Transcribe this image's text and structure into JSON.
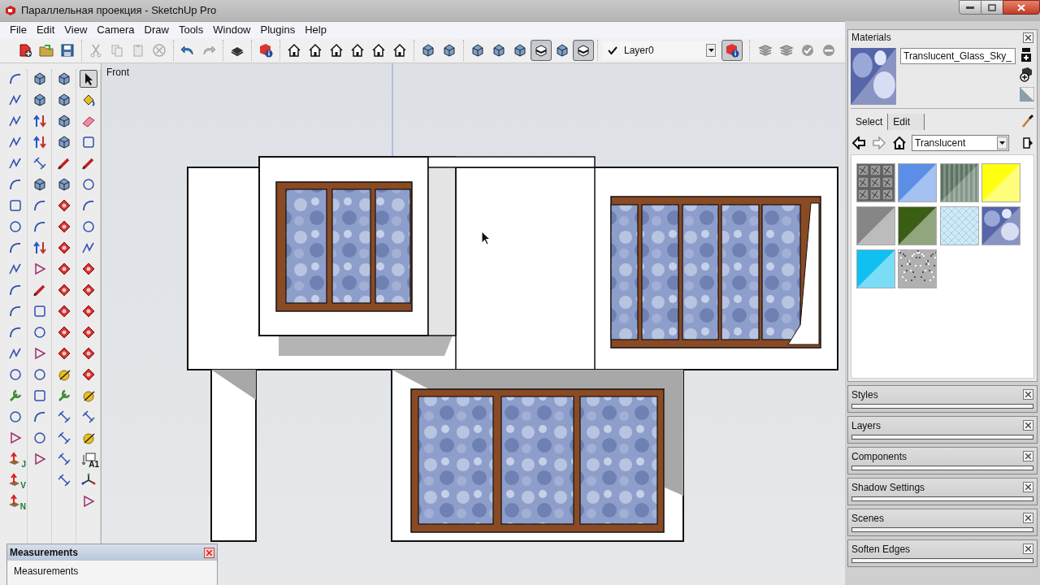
{
  "window": {
    "title": "Параллельная проекция - SketchUp Pro"
  },
  "menu": [
    "File",
    "Edit",
    "View",
    "Camera",
    "Draw",
    "Tools",
    "Window",
    "Plugins",
    "Help"
  ],
  "toolbar": {
    "groups": [
      [
        {
          "kind": "new",
          "selected": false
        },
        {
          "kind": "open",
          "selected": false
        },
        {
          "kind": "save",
          "selected": false
        }
      ],
      [
        {
          "kind": "cut",
          "selected": false
        },
        {
          "kind": "copy",
          "selected": false
        },
        {
          "kind": "paste",
          "selected": false
        },
        {
          "kind": "delete",
          "selected": false
        }
      ],
      [
        {
          "kind": "undo",
          "selected": false
        },
        {
          "kind": "redo",
          "selected": false
        }
      ],
      [
        {
          "kind": "print",
          "selected": false
        }
      ],
      [
        {
          "kind": "info",
          "selected": false
        }
      ],
      [
        {
          "kind": "house",
          "selected": false
        },
        {
          "kind": "house",
          "selected": false
        },
        {
          "kind": "house",
          "selected": false
        },
        {
          "kind": "house",
          "selected": false
        },
        {
          "kind": "house",
          "selected": false
        },
        {
          "kind": "house",
          "selected": false
        }
      ],
      [
        {
          "kind": "cube",
          "selected": false
        },
        {
          "kind": "cube",
          "selected": false
        }
      ],
      [
        {
          "kind": "cube",
          "selected": false
        },
        {
          "kind": "cube",
          "selected": false
        },
        {
          "kind": "cube",
          "selected": false
        },
        {
          "kind": "style",
          "selected": true
        },
        {
          "kind": "cube",
          "selected": false
        },
        {
          "kind": "style",
          "selected": true
        }
      ]
    ],
    "layer": {
      "name": "Layer0",
      "checked": true,
      "info_selected": true
    },
    "tail": [
      {
        "kind": "layers",
        "selected": false
      },
      {
        "kind": "layers",
        "selected": false
      },
      {
        "kind": "check",
        "selected": false
      },
      {
        "kind": "minus",
        "selected": false
      }
    ]
  },
  "tools": [
    [
      {
        "kind": "arc",
        "selected": false
      },
      {
        "kind": "zigzag",
        "selected": false
      },
      {
        "kind": "zigzag",
        "selected": false
      },
      {
        "kind": "zigzag",
        "selected": false
      },
      {
        "kind": "zigzag",
        "selected": false
      },
      {
        "kind": "arc",
        "selected": false
      },
      {
        "kind": "square",
        "selected": false
      },
      {
        "kind": "circle",
        "selected": false
      },
      {
        "kind": "arc",
        "selected": false
      },
      {
        "kind": "zigzag",
        "selected": false
      },
      {
        "kind": "arc",
        "selected": false
      },
      {
        "kind": "arc",
        "selected": false
      },
      {
        "kind": "arc",
        "selected": false
      },
      {
        "kind": "zigzag",
        "selected": false
      },
      {
        "kind": "circle",
        "selected": false
      },
      {
        "kind": "wrench",
        "selected": false
      },
      {
        "kind": "circle",
        "selected": false
      },
      {
        "kind": "polygon",
        "selected": false
      },
      {
        "kind": "axis",
        "label": "J",
        "selected": false
      },
      {
        "kind": "axis",
        "label": "V",
        "selected": false
      },
      {
        "kind": "axis",
        "label": "N",
        "selected": false
      }
    ],
    [
      {
        "kind": "cube",
        "selected": false
      },
      {
        "kind": "cube",
        "selected": false
      },
      {
        "kind": "push",
        "selected": false
      },
      {
        "kind": "push",
        "selected": false
      },
      {
        "kind": "lines",
        "selected": false
      },
      {
        "kind": "cube",
        "selected": false
      },
      {
        "kind": "arc",
        "selected": false
      },
      {
        "kind": "arc",
        "selected": false
      },
      {
        "kind": "push",
        "selected": false
      },
      {
        "kind": "polygon",
        "selected": false
      },
      {
        "kind": "pencil",
        "selected": false
      },
      {
        "kind": "square",
        "selected": false
      },
      {
        "kind": "circle",
        "selected": false
      },
      {
        "kind": "polygon",
        "selected": false
      },
      {
        "kind": "circle",
        "selected": false
      },
      {
        "kind": "square",
        "selected": false
      },
      {
        "kind": "arc",
        "selected": false
      },
      {
        "kind": "circle",
        "selected": false
      },
      {
        "kind": "polygon",
        "selected": false
      }
    ],
    [
      {
        "kind": "cube",
        "selected": false
      },
      {
        "kind": "cube",
        "selected": false
      },
      {
        "kind": "cube",
        "selected": false
      },
      {
        "kind": "cube",
        "selected": false
      },
      {
        "kind": "pencil",
        "selected": false
      },
      {
        "kind": "cube",
        "selected": false
      },
      {
        "kind": "red",
        "selected": false
      },
      {
        "kind": "red",
        "selected": false
      },
      {
        "kind": "red",
        "selected": false
      },
      {
        "kind": "red",
        "selected": false
      },
      {
        "kind": "red",
        "selected": false
      },
      {
        "kind": "red",
        "selected": false
      },
      {
        "kind": "red",
        "selected": false
      },
      {
        "kind": "red",
        "selected": false
      },
      {
        "kind": "tape",
        "selected": false
      },
      {
        "kind": "wrench",
        "selected": false
      },
      {
        "kind": "lines",
        "selected": false
      },
      {
        "kind": "lines",
        "selected": false
      },
      {
        "kind": "lines",
        "selected": false
      },
      {
        "kind": "lines",
        "selected": false
      }
    ],
    [
      {
        "kind": "select",
        "selected": true
      },
      {
        "kind": "paint",
        "selected": false
      },
      {
        "kind": "eraser",
        "selected": false
      },
      {
        "kind": "square",
        "selected": false
      },
      {
        "kind": "pencil",
        "selected": false
      },
      {
        "kind": "circle",
        "selected": false
      },
      {
        "kind": "arc",
        "selected": false
      },
      {
        "kind": "circle",
        "selected": false
      },
      {
        "kind": "zigzag",
        "selected": false
      },
      {
        "kind": "red",
        "selected": false
      },
      {
        "kind": "red",
        "selected": false
      },
      {
        "kind": "red",
        "selected": false
      },
      {
        "kind": "red",
        "selected": false
      },
      {
        "kind": "red",
        "selected": false
      },
      {
        "kind": "red",
        "selected": false
      },
      {
        "kind": "tape",
        "selected": false
      },
      {
        "kind": "lines",
        "selected": false
      },
      {
        "kind": "tape",
        "selected": false
      },
      {
        "kind": "text",
        "label": "A1",
        "selected": false
      },
      {
        "kind": "axes",
        "selected": false
      },
      {
        "kind": "polygon",
        "selected": false
      }
    ]
  ],
  "viewport": {
    "view_label": "Front"
  },
  "measurements": {
    "title": "Measurements",
    "label": "Measurements"
  },
  "materials": {
    "title": "Materials",
    "preview": {
      "kind": "sky"
    },
    "name": "Translucent_Glass_Sky_",
    "tabs": [
      {
        "label": "Select",
        "selected": true
      },
      {
        "label": "Edit",
        "selected": false
      }
    ],
    "collection": "Translucent",
    "swatches": [
      {
        "kind": "texture",
        "color": "#7a7a7a"
      },
      {
        "kind": "solid",
        "color": "#5b8fe6"
      },
      {
        "kind": "stripes",
        "color": "#7f9484"
      },
      {
        "kind": "solid",
        "color": "#ffff10"
      },
      {
        "kind": "solid",
        "color": "#868686"
      },
      {
        "kind": "solid",
        "color": "#3a5e14"
      },
      {
        "kind": "grid",
        "color": "#cfeaf7"
      },
      {
        "kind": "sky",
        "color": "#5666a8"
      },
      {
        "kind": "solid",
        "color": "#10c0f0"
      },
      {
        "kind": "noise",
        "color": "#b0b0b0"
      }
    ]
  },
  "trays": [
    {
      "title": "Styles"
    },
    {
      "title": "Layers"
    },
    {
      "title": "Components"
    },
    {
      "title": "Shadow Settings"
    },
    {
      "title": "Scenes"
    },
    {
      "title": "Soften Edges"
    }
  ]
}
